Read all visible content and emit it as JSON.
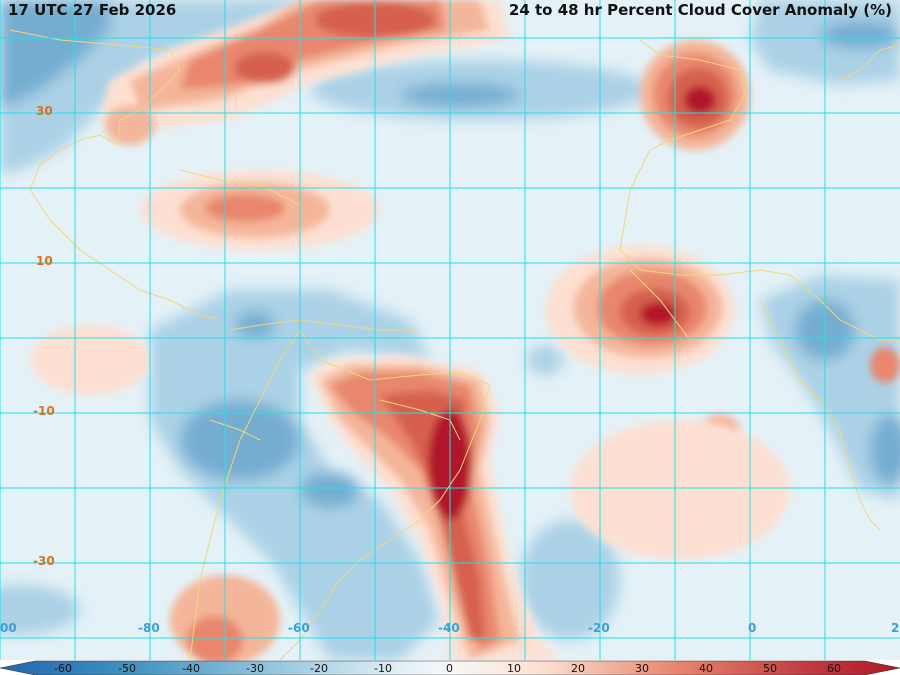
{
  "header": {
    "timestamp": "17 UTC 27 Feb 2026",
    "product": "24 to 48 hr Percent Cloud Cover Anomaly (%)"
  },
  "grid": {
    "lat_labels": [
      "30",
      "10",
      "-10",
      "-30"
    ],
    "lon_labels": [
      "00",
      "-80",
      "-60",
      "-40",
      "-20",
      "0",
      "2"
    ]
  },
  "colorbar": {
    "tick_labels": [
      "-60",
      "-50",
      "-40",
      "-30",
      "-20",
      "-10",
      "0",
      "10",
      "20",
      "30",
      "40",
      "50",
      "60"
    ],
    "colors": [
      "#2166ac",
      "#4393c3",
      "#74add1",
      "#92c5de",
      "#abd1e6",
      "#d1e5f0",
      "#f7f7f7",
      "#fde0d2",
      "#f4b69a",
      "#e8876d",
      "#d6604d",
      "#c03a3e",
      "#b2182b"
    ]
  },
  "style": {
    "grid_color": "#22e0e8",
    "coast_color": "#f0d77a",
    "ocean_color": "#e4f1f7"
  }
}
